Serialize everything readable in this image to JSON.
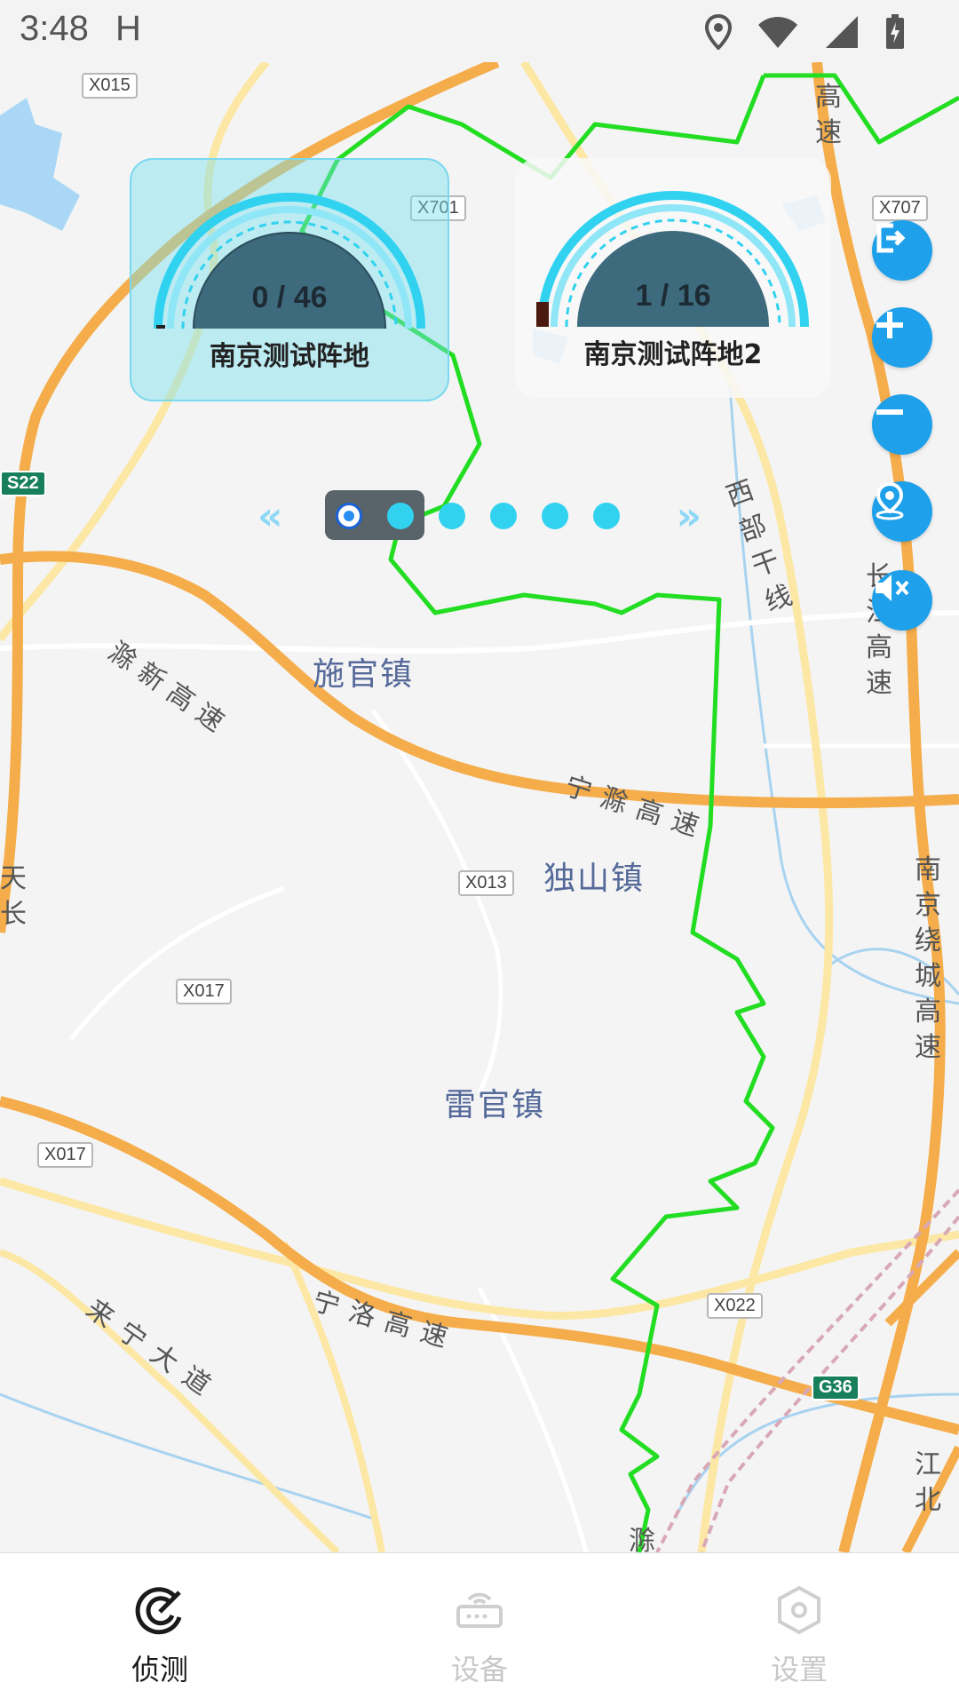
{
  "status_bar": {
    "time": "3:48",
    "indicator": "H",
    "icons": [
      "location-icon",
      "wifi-icon",
      "signal-icon",
      "battery-charging-icon"
    ]
  },
  "map": {
    "place_labels": [
      "施官镇",
      "独山镇",
      "雷官镇"
    ],
    "road_labels": [
      "滁新高速",
      "宁滁高速",
      "宁洛高速",
      "来宁大道",
      "西部干线",
      "长江高速",
      "南京绕城高速",
      "江北",
      "天长",
      "高速",
      "滁"
    ],
    "route_badges": [
      "X015",
      "X701",
      "X707",
      "S22",
      "X013",
      "X017",
      "X017",
      "X022",
      "G36"
    ],
    "route_color": "#22dd22"
  },
  "gauges": [
    {
      "count": "0 / 46",
      "name": "南京测试阵地",
      "selected": true
    },
    {
      "count": "1 / 16",
      "name": "南京测试阵地2",
      "selected": false
    }
  ],
  "pager": {
    "prev": "«",
    "next": "»",
    "page_count": 6,
    "current_page": 1
  },
  "side_controls": [
    "exit-icon",
    "zoom-in-icon",
    "zoom-out-icon",
    "locate-icon",
    "mute-icon"
  ],
  "bottom_nav": {
    "items": [
      {
        "label": "侦测",
        "icon": "detect-icon",
        "active": true
      },
      {
        "label": "设备",
        "icon": "device-icon",
        "active": false
      },
      {
        "label": "设置",
        "icon": "settings-icon",
        "active": false
      }
    ]
  },
  "colors": {
    "accent": "#1ea0ea",
    "gauge_cyan": "#31d2f0",
    "highway": "#f4ad4a"
  }
}
